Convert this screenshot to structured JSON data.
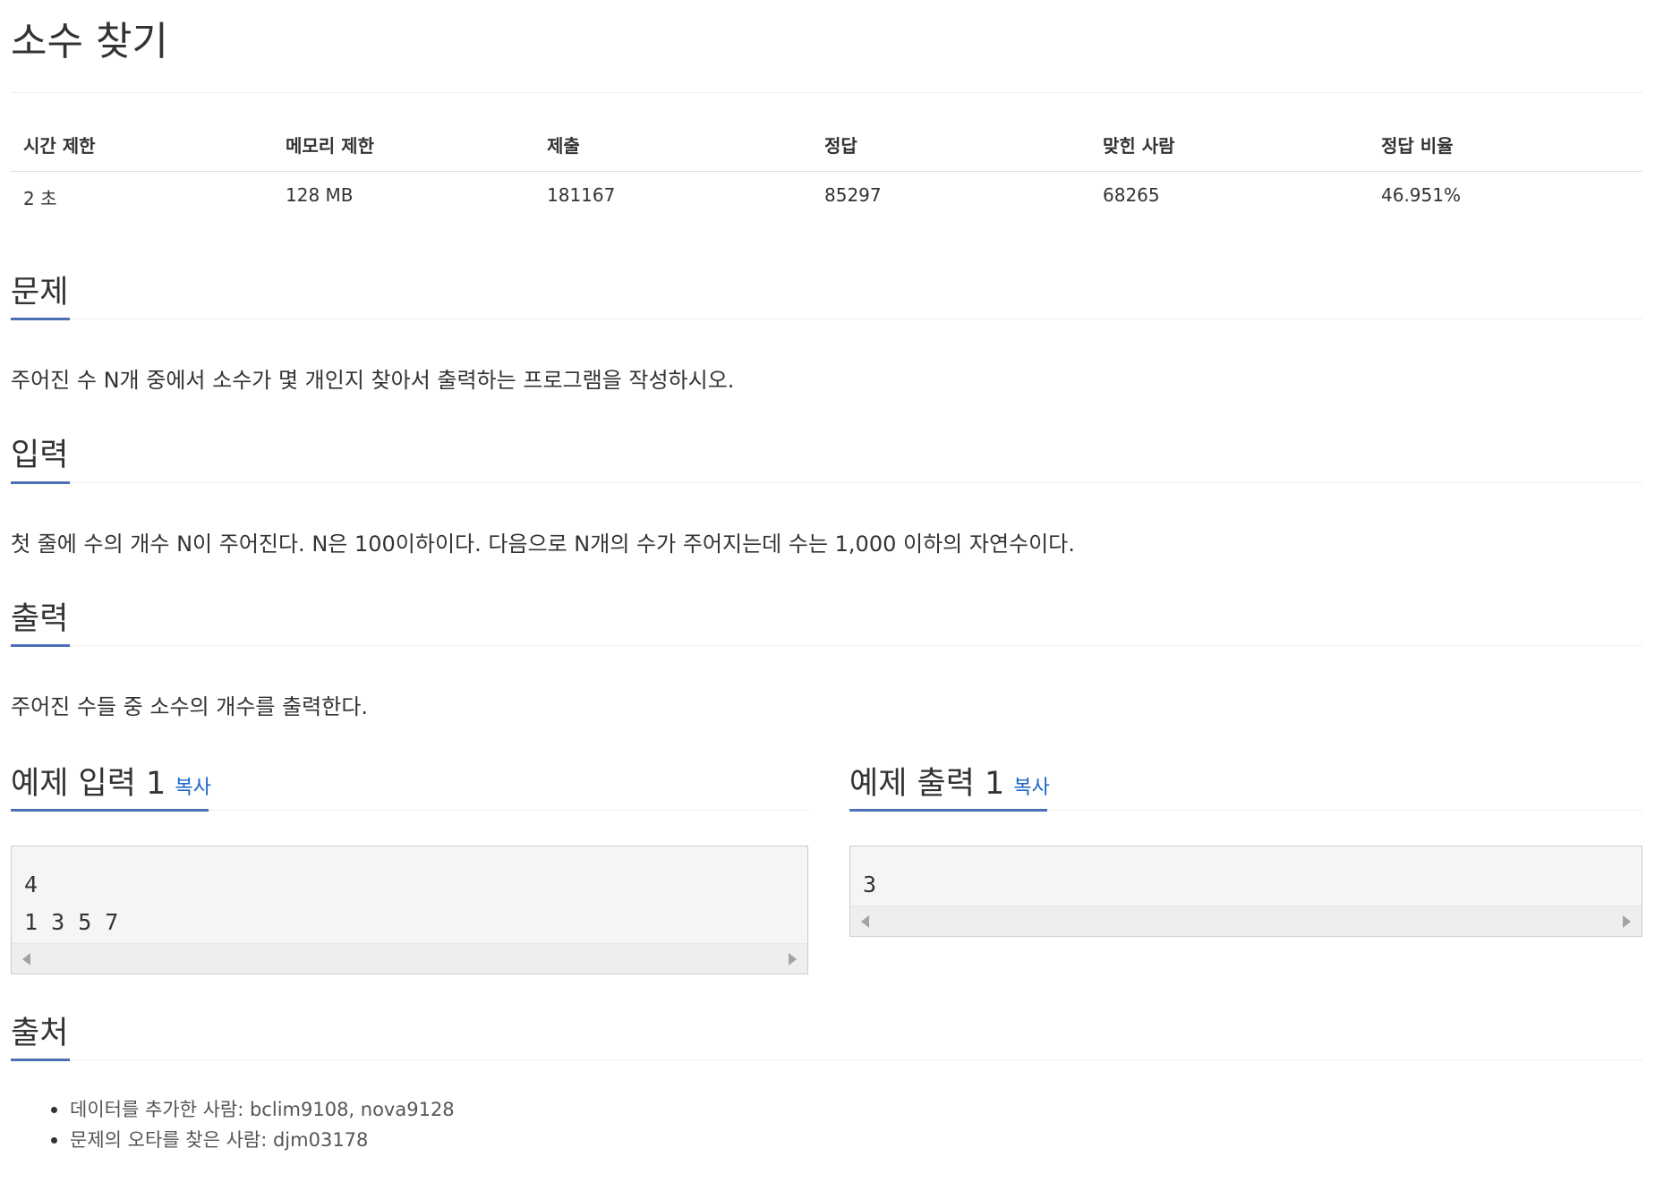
{
  "title": "소수 찾기",
  "stats": {
    "headers": [
      "시간 제한",
      "메모리 제한",
      "제출",
      "정답",
      "맞힌 사람",
      "정답 비율"
    ],
    "values": [
      "2 초",
      "128 MB",
      "181167",
      "85297",
      "68265",
      "46.951%"
    ]
  },
  "sections": {
    "problem": {
      "heading": "문제",
      "text": "주어진 수 N개 중에서 소수가 몇 개인지 찾아서 출력하는 프로그램을 작성하시오."
    },
    "input": {
      "heading": "입력",
      "text": "첫 줄에 수의 개수 N이 주어진다. N은 100이하이다. 다음으로 N개의 수가 주어지는데 수는 1,000 이하의 자연수이다."
    },
    "output": {
      "heading": "출력",
      "text": "주어진 수들 중 소수의 개수를 출력한다."
    }
  },
  "samples": {
    "input": {
      "heading": "예제 입력 1",
      "copy_label": "복사",
      "content": "4\n1 3 5 7"
    },
    "output": {
      "heading": "예제 출력 1",
      "copy_label": "복사",
      "content": "3"
    }
  },
  "source": {
    "heading": "출처",
    "items": [
      "데이터를 추가한 사람: bclim9108, nova9128",
      "문제의 오타를 찾은 사람: djm03178"
    ]
  },
  "colors": {
    "accent_underline": "#4a6fb5",
    "link": "#1a65c7"
  }
}
